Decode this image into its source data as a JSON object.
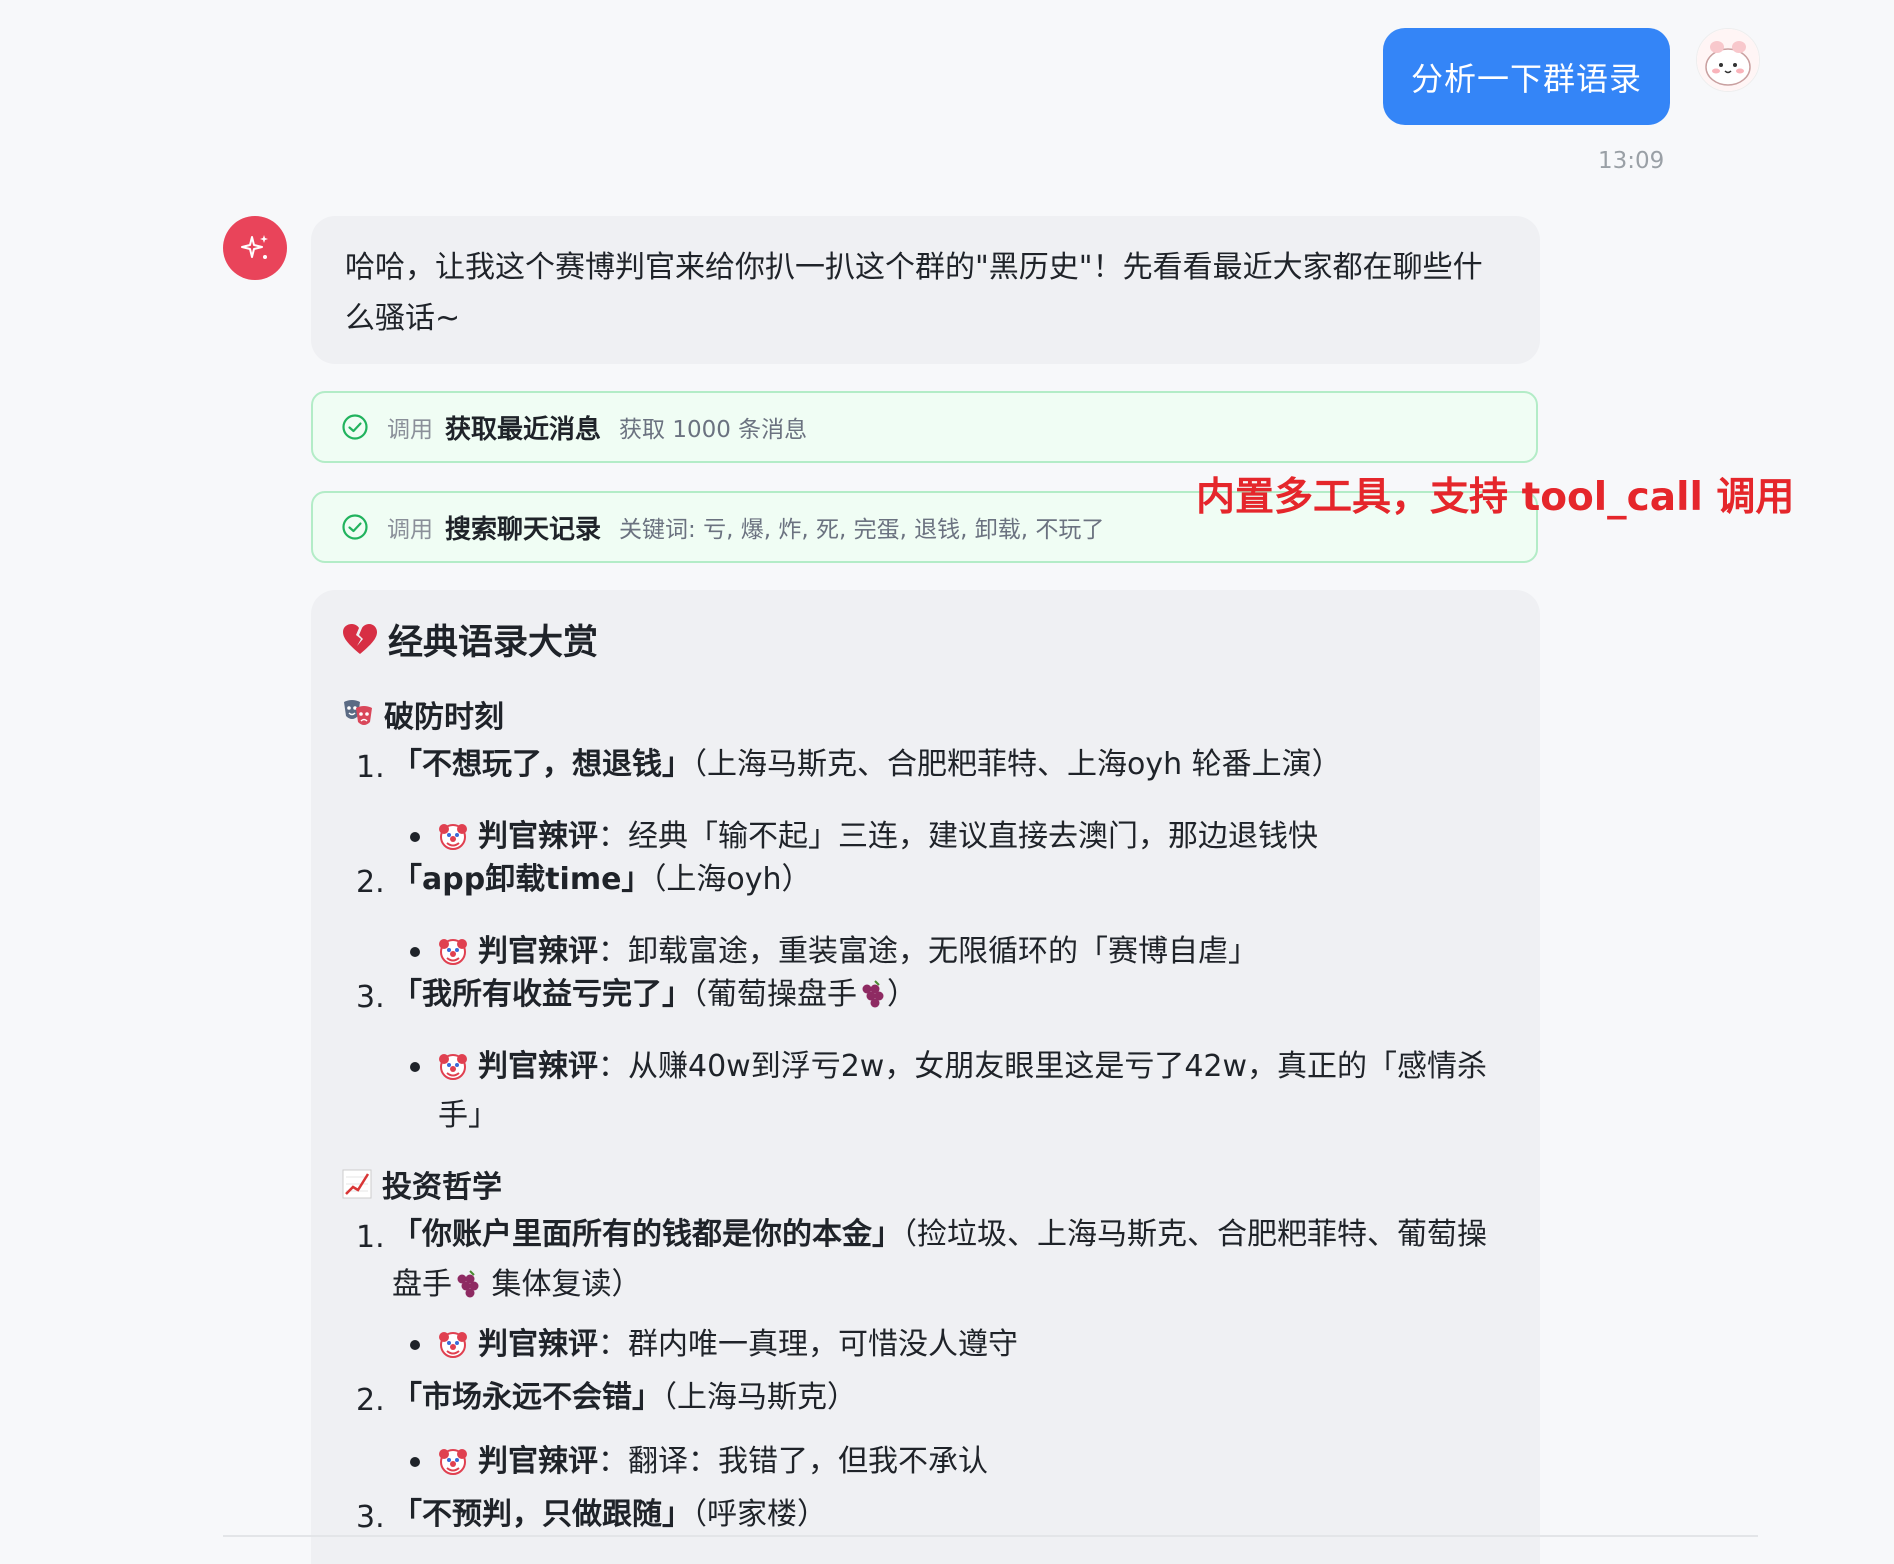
{
  "user_message": {
    "text": "分析一下群语录",
    "time": "13:09"
  },
  "ai_intro": "哈哈，让我这个赛博判官来给你扒一扒这个群的\"黑历史\"！先看看最近大家都在聊些什么骚话~",
  "tool_calls": [
    {
      "prefix": "调用",
      "name": "获取最近消息",
      "detail": "获取 1000 条消息",
      "status": "success"
    },
    {
      "prefix": "调用",
      "name": "搜索聊天记录",
      "detail": "关键词: 亏, 爆, 炸, 死, 完蛋, 退钱, 卸载, 不玩了",
      "status": "success"
    }
  ],
  "annotation": "内置多工具，支持 tool_call 调用",
  "report": {
    "title": "经典语录大赏",
    "title_icon": "broken-heart-icon",
    "sections": [
      {
        "heading": "破防时刻",
        "icon": "performing-arts-icon",
        "items": [
          {
            "num": "1.",
            "quote": "「不想玩了，想退钱」",
            "source": "（上海马斯克、合肥粑菲特、上海oyh 轮番上演）",
            "comment_label": "判官辣评",
            "comment": "：经典「输不起」三连，建议直接去澳门，那边退钱快"
          },
          {
            "num": "2.",
            "quote": "「app卸载time」",
            "source": "（上海oyh）",
            "comment_label": "判官辣评",
            "comment": "：卸载富途，重装富途，无限循环的「赛博自虐」"
          },
          {
            "num": "3.",
            "quote": "「我所有收益亏完了」",
            "source": "（葡萄操盘手",
            "source_end": "）",
            "comment_label": "判官辣评",
            "comment": "：从赚40w到浮亏2w，女朋友眼里这是亏了42w，真正的「感情杀手」"
          }
        ]
      },
      {
        "heading": "投资哲学",
        "icon": "chart-increasing-icon",
        "items": [
          {
            "num": "1.",
            "quote": "「你账户里面所有的钱都是你的本金」",
            "source": "（捡垃圾、上海马斯克、合肥粑菲特、葡萄操盘手",
            "source_end": " 集体复读）",
            "comment_label": "判官辣评",
            "comment": "：群内唯一真理，可惜没人遵守"
          },
          {
            "num": "2.",
            "quote": "「市场永远不会错」",
            "source": "（上海马斯克）",
            "comment_label": "判官辣评",
            "comment": "：翻译：我错了，但我不承认"
          },
          {
            "num": "3.",
            "quote": "「不预判，只做跟随」",
            "source": "（呼家楼）"
          }
        ]
      }
    ]
  },
  "colors": {
    "user_bubble": "#3485f7",
    "ai_avatar": "#e9445a",
    "tool_bg": "#f0fdf4",
    "tool_border": "#b3ecc7",
    "annotation": "#e5262b"
  }
}
